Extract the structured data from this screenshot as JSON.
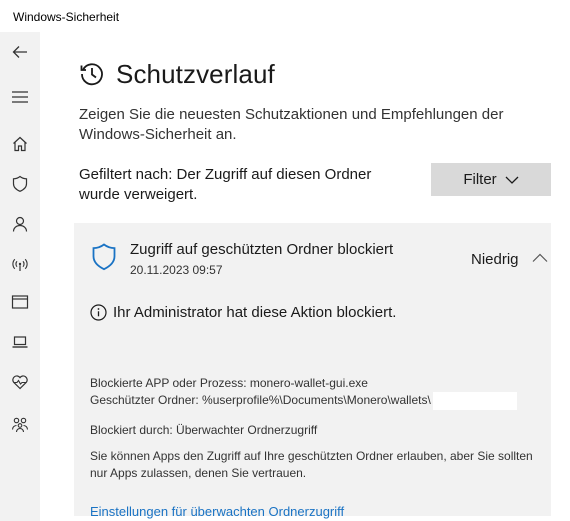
{
  "window": {
    "title": "Windows-Sicherheit"
  },
  "sidebar": {
    "items": [
      {
        "icon": "back-arrow-icon"
      },
      {
        "icon": "hamburger-menu-icon"
      },
      {
        "icon": "home-icon"
      },
      {
        "icon": "shield-icon"
      },
      {
        "icon": "person-icon"
      },
      {
        "icon": "wireless-icon"
      },
      {
        "icon": "app-browser-icon"
      },
      {
        "icon": "laptop-icon"
      },
      {
        "icon": "heart-pulse-icon"
      },
      {
        "icon": "family-icon"
      }
    ]
  },
  "page": {
    "title": "Schutzverlauf",
    "description": "Zeigen Sie die neuesten Schutzaktionen und Empfehlungen der Windows-Sicherheit an.",
    "filter_text": "Gefiltert nach: Der Zugriff auf diesen Ordner wurde verweigert.",
    "filter_button": "Filter"
  },
  "card": {
    "title": "Zugriff auf geschützten Ordner blockiert",
    "date": "20.11.2023 09:57",
    "severity": "Niedrig",
    "info": "Ihr Administrator hat diese Aktion blockiert.",
    "blocked_app": "Blockierte APP oder Prozess:  monero-wallet-gui.exe",
    "protected_folder": "Geschützter Ordner:  %userprofile%\\Documents\\Monero\\wallets\\",
    "blocked_by": "Blockiert durch:  Überwachter Ordnerzugriff",
    "explanation": "Sie können Apps den Zugriff auf Ihre geschützten Ordner erlauben, aber Sie sollten nur Apps zulassen, denen Sie vertrauen.",
    "settings_link": "Einstellungen für überwachten Ordnerzugriff"
  },
  "colors": {
    "accent_blue": "#1a73c4",
    "sidebar_bg": "#f2f2f2",
    "card_bg": "#f2f2f2",
    "button_bg": "#d9d9d9"
  }
}
